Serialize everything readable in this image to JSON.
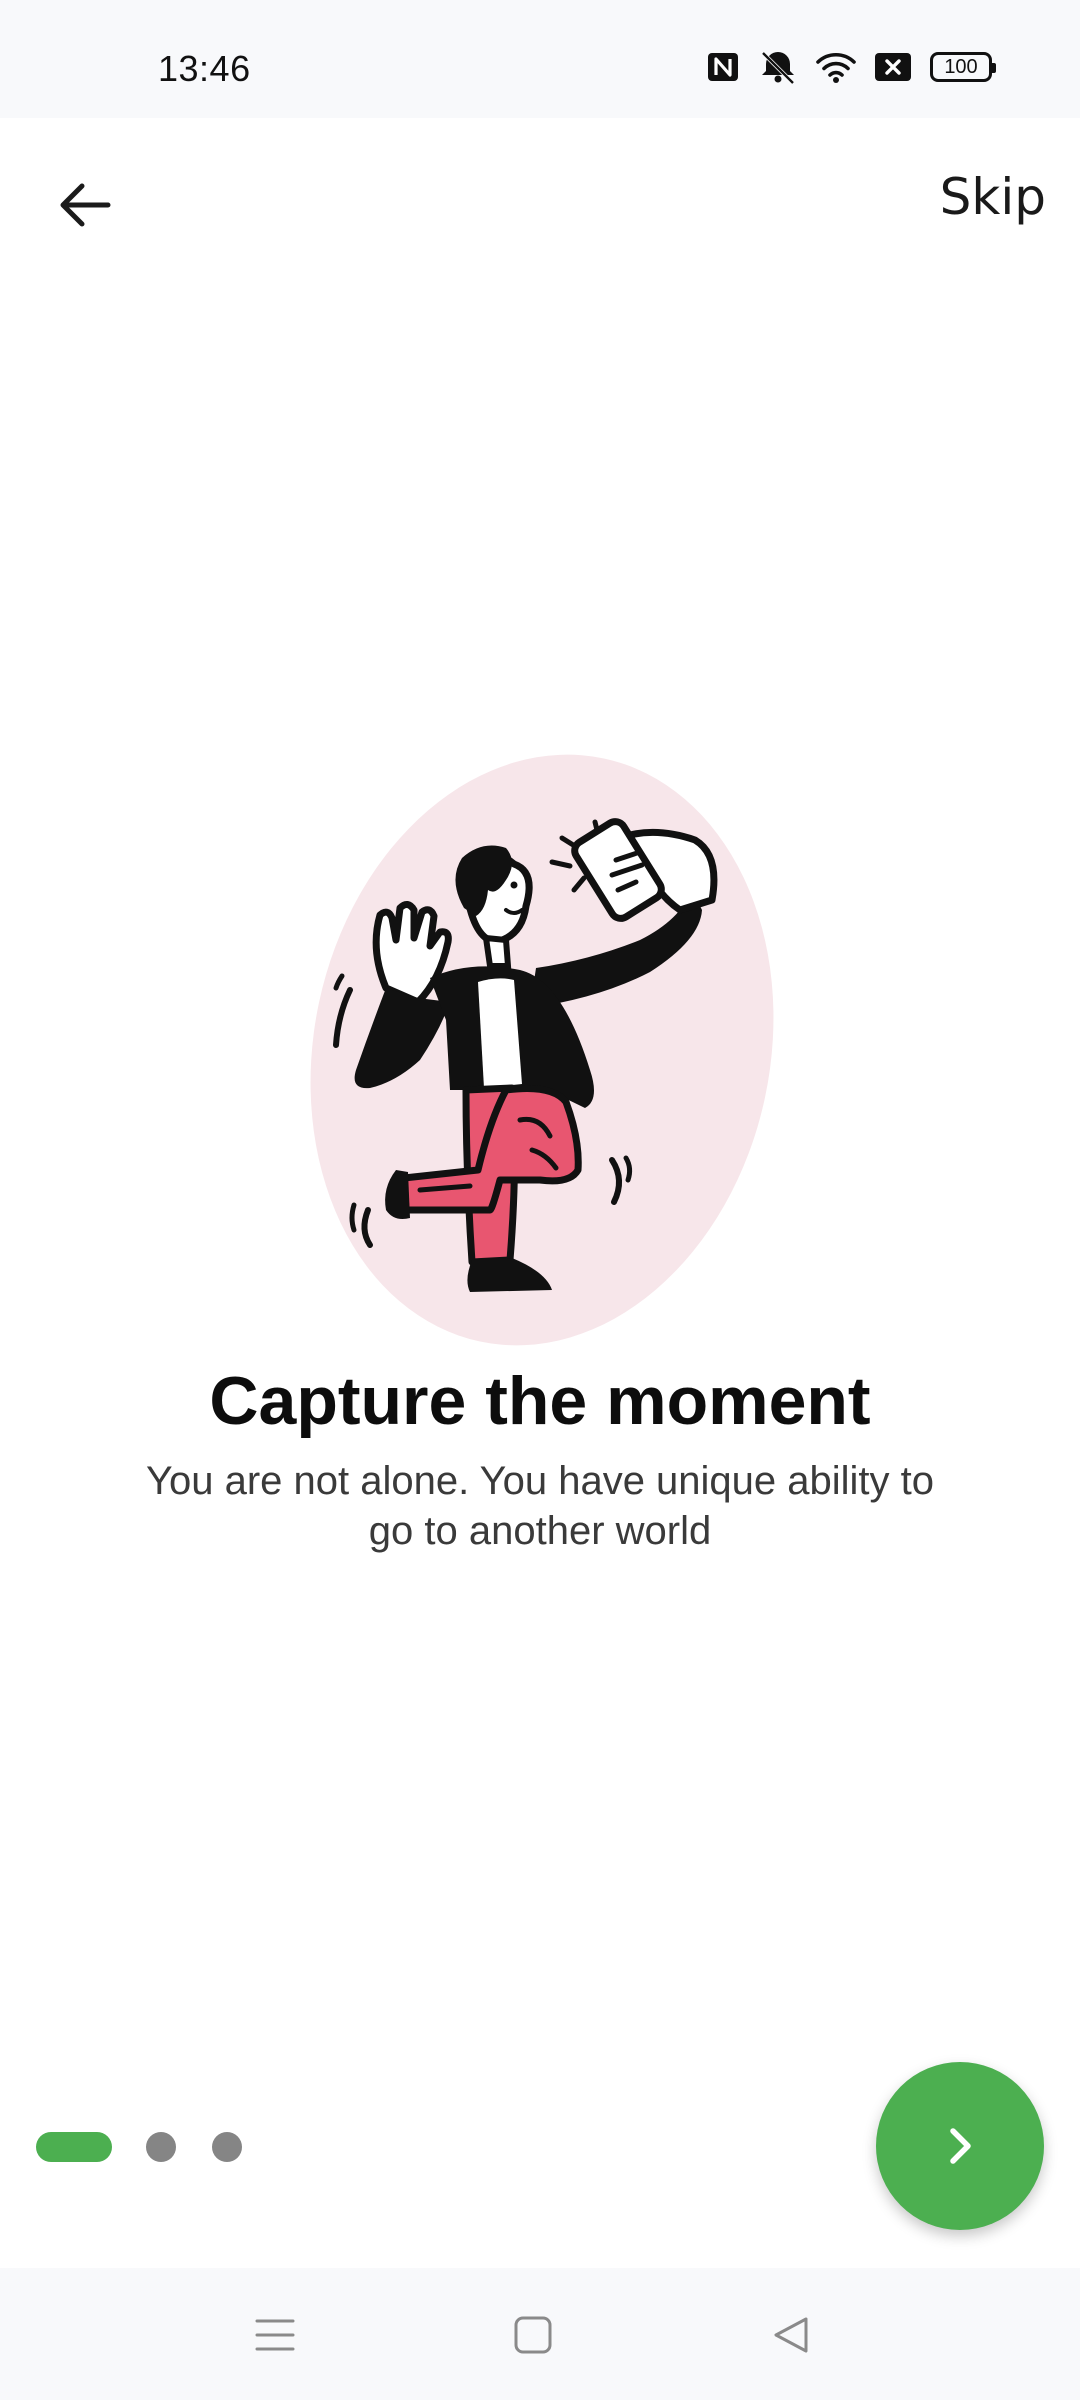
{
  "status_bar": {
    "time": "13:46",
    "battery": "100",
    "icons": [
      "nfc-icon",
      "vibrate-off-icon",
      "wifi-icon",
      "no-sim-icon",
      "battery-icon"
    ]
  },
  "top_bar": {
    "back_icon": "arrow-left-icon",
    "skip_label": "Skip"
  },
  "onboarding": {
    "illustration": "person-taking-selfie-illustration",
    "title": "Capture the moment",
    "subtitle": "You are not alone. You have unique ability to go to another world",
    "page_count": 3,
    "current_page": 1
  },
  "next_button": {
    "icon": "chevron-right-icon"
  },
  "nav_bar": {
    "icons": [
      "menu-icon",
      "home-square-icon",
      "back-triangle-icon"
    ]
  },
  "colors": {
    "accent": "#4caf50",
    "blob": "#f7e6ea",
    "pants": "#e85670",
    "inactive_dot": "#858585"
  }
}
